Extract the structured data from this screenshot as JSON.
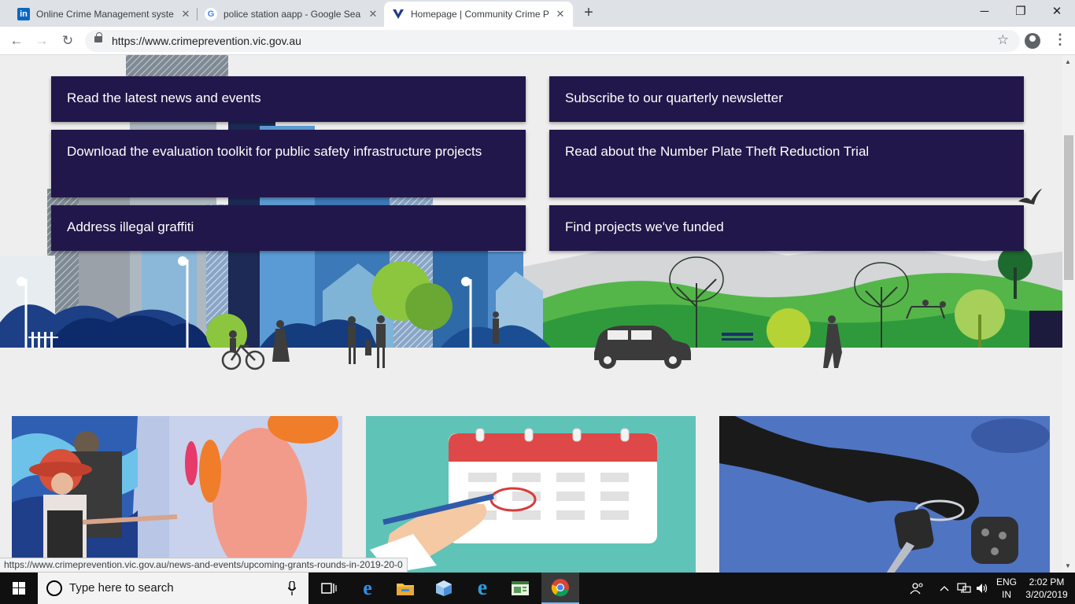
{
  "browser": {
    "tabs": [
      {
        "title": "Online Crime Management syste",
        "favicon": "linkedin-icon",
        "favicon_text": "in"
      },
      {
        "title": "police station aapp - Google Sea",
        "favicon": "google-icon",
        "favicon_text": "G"
      },
      {
        "title": "Homepage | Community Crime P",
        "favicon": "vic-gov-icon",
        "active": true
      }
    ],
    "tab_close": "✕",
    "new_tab": "+",
    "url": "https://www.crimeprevention.vic.gov.au",
    "window_controls": {
      "minimize": "─",
      "restore": "❐",
      "close": "✕"
    },
    "nav": {
      "back": "←",
      "forward": "→",
      "reload": "↻"
    },
    "star": "☆",
    "menu": "⋮",
    "status_url": "https://www.crimeprevention.vic.gov.au/news-and-events/upcoming-grants-rounds-in-2019-20-0"
  },
  "page": {
    "links": [
      {
        "label": "Read the latest news and events"
      },
      {
        "label": "Subscribe to our quarterly newsletter"
      },
      {
        "label": "Download the evaluation toolkit for public safety infrastructure projects"
      },
      {
        "label": "Read about the Number Plate Theft Reduction Trial"
      },
      {
        "label": "Address illegal graffiti"
      },
      {
        "label": "Find projects we've funded"
      }
    ],
    "colors": {
      "card_bg": "#22174a",
      "card_text": "#ffffff",
      "page_bg": "#eeeeee",
      "calendar_bg": "#5fc3b8",
      "keys_bg": "#4f74c2"
    },
    "thumbnails": [
      {
        "name": "mural-painting-image"
      },
      {
        "name": "calendar-image"
      },
      {
        "name": "car-keys-image"
      }
    ]
  },
  "taskbar": {
    "search_placeholder": "Type here to search",
    "icons": [
      "windows-start-icon",
      "task-view-icon",
      "edge-icon",
      "file-explorer-icon",
      "app-cube-icon",
      "internet-explorer-icon",
      "app-window-icon",
      "chrome-icon"
    ],
    "lang_line1": "ENG",
    "lang_line2": "IN",
    "time": "2:02 PM",
    "date": "3/20/2019"
  }
}
